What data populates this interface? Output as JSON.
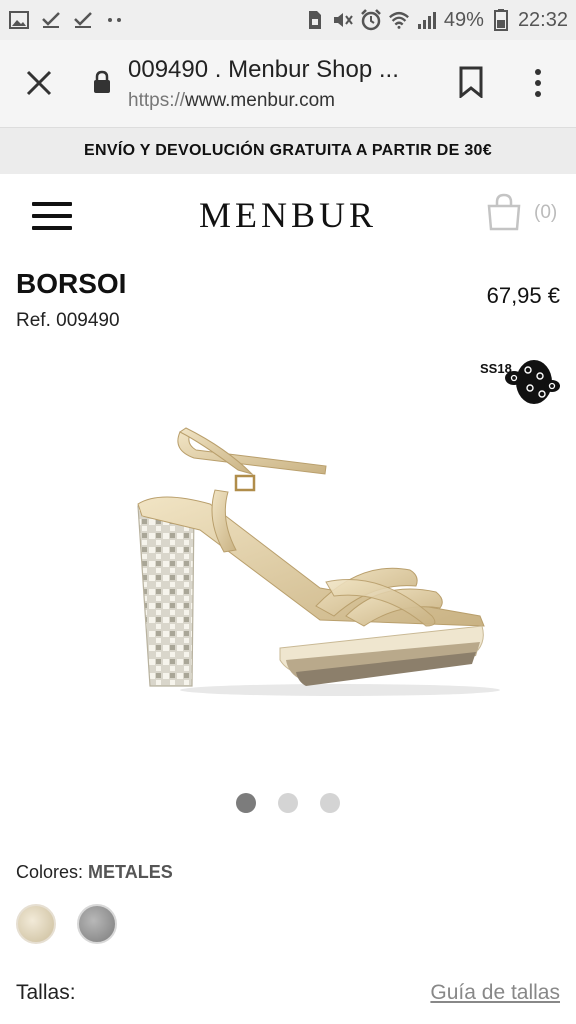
{
  "status_bar": {
    "battery": "49%",
    "time": "22:32",
    "left_icons": [
      "image-icon",
      "check-icon",
      "check-icon",
      "more-dots-icon"
    ],
    "right_icons": [
      "sim-icon",
      "mute-icon",
      "alarm-icon",
      "wifi-icon",
      "signal-icon",
      "battery-icon"
    ]
  },
  "browser": {
    "page_title": "009490 . Menbur Shop ...",
    "url_protocol": "https://",
    "url_host": "www.menbur.com"
  },
  "promo": {
    "text": "ENVÍO Y DEVOLUCIÓN GRATUITA A PARTIR DE 30€"
  },
  "header": {
    "logo": "MENBUR",
    "cart_count": "(0)"
  },
  "product": {
    "name": "BORSOI",
    "ref": "Ref. 009490",
    "price": "67,95 €",
    "season_badge": "SS18",
    "image_count": 3,
    "active_image": 0
  },
  "colors": {
    "label": "Colores:",
    "selected": "METALES",
    "swatches": [
      {
        "name": "gold",
        "color": "#d9ccae"
      },
      {
        "name": "silver",
        "color": "#9a9a9a"
      }
    ]
  },
  "sizes": {
    "label": "Tallas:",
    "guide_link": "Guía de tallas"
  }
}
